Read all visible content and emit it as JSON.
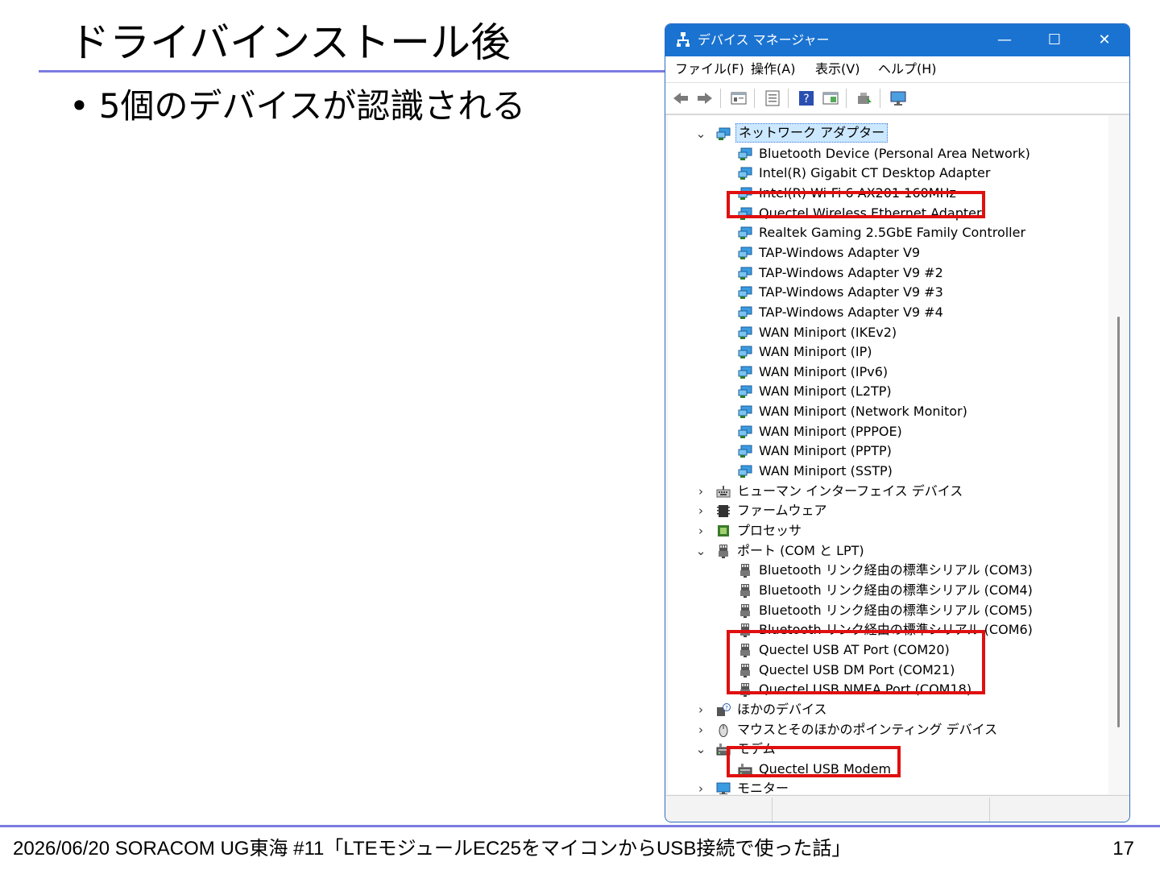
{
  "slide": {
    "title": "ドライバインストール後",
    "bullet": "5個のデバイスが認識される",
    "footer": "2026/06/20 SORACOM UG東海 #11「LTEモジュールEC25をマイコンからUSB接続で使った話」",
    "page_number": "17"
  },
  "window": {
    "title": "デバイス マネージャー",
    "controls": {
      "minimize": "—",
      "maximize": "☐",
      "close": "✕"
    },
    "menu": [
      "ファイル(F)",
      "操作(A)",
      "表示(V)",
      "ヘルプ(H)"
    ],
    "toolbar_icons": [
      "back-icon",
      "forward-icon",
      "properties-icon",
      "update-driver-icon",
      "help-icon",
      "view-icon",
      "scan-hardware-icon",
      "monitor-icon"
    ],
    "tree": {
      "network_category": "ネットワーク アダプター",
      "network_devices": [
        "Bluetooth Device (Personal Area Network)",
        "Intel(R) Gigabit CT Desktop Adapter",
        "Intel(R) Wi-Fi 6 AX201 160MHz",
        "Quectel Wireless Ethernet Adapter",
        "Realtek Gaming 2.5GbE Family Controller",
        "TAP-Windows Adapter V9",
        "TAP-Windows Adapter V9 #2",
        "TAP-Windows Adapter V9 #3",
        "TAP-Windows Adapter V9 #4",
        "WAN Miniport (IKEv2)",
        "WAN Miniport (IP)",
        "WAN Miniport (IPv6)",
        "WAN Miniport (L2TP)",
        "WAN Miniport (Network Monitor)",
        "WAN Miniport (PPPOE)",
        "WAN Miniport (PPTP)",
        "WAN Miniport (SSTP)"
      ],
      "hid_category": "ヒューマン インターフェイス デバイス",
      "firmware_category": "ファームウェア",
      "processor_category": "プロセッサ",
      "ports_category": "ポート (COM と LPT)",
      "port_devices": [
        "Bluetooth リンク経由の標準シリアル (COM3)",
        "Bluetooth リンク経由の標準シリアル (COM4)",
        "Bluetooth リンク経由の標準シリアル (COM5)",
        "Bluetooth リンク経由の標準シリアル (COM6)",
        "Quectel USB AT Port (COM20)",
        "Quectel USB DM Port (COM21)",
        "Quectel USB NMEA Port (COM18)"
      ],
      "other_category": "ほかのデバイス",
      "mouse_category": "マウスとそのほかのポインティング デバイス",
      "modem_category": "モデム",
      "modem_devices": [
        "Quectel USB Modem"
      ],
      "monitor_category": "モニター"
    }
  },
  "colors": {
    "accent_rule": "#7b7be0",
    "titlebar": "#1a73d1",
    "highlight_box": "#e01010",
    "selection": "#cce8ff"
  }
}
